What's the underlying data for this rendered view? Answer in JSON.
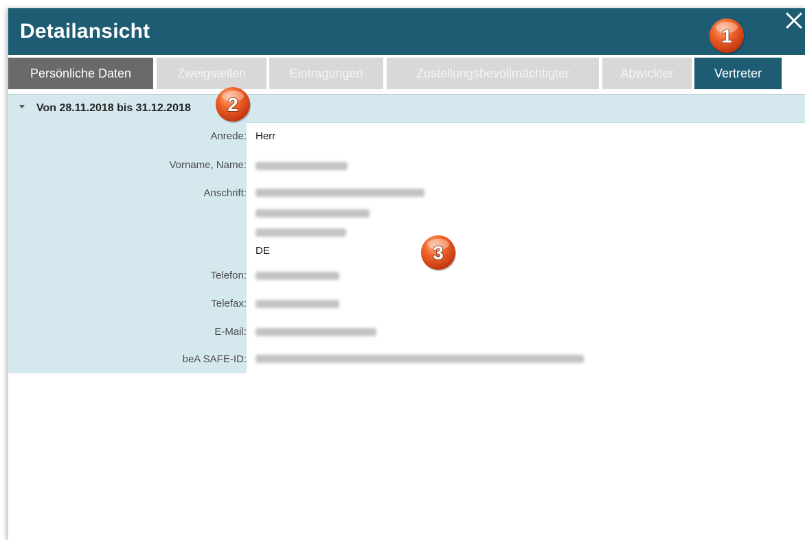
{
  "window": {
    "title": "Detailansicht"
  },
  "tabs": [
    {
      "label": "Persönliche Daten",
      "state": "active"
    },
    {
      "label": "Zweigstellen",
      "state": "inactive"
    },
    {
      "label": "Eintragungen",
      "state": "inactive"
    },
    {
      "label": "Zustellungsbevollmächtigter",
      "state": "inactive"
    },
    {
      "label": "Abwickler",
      "state": "inactive"
    },
    {
      "label": "Vertreter",
      "state": "selected"
    }
  ],
  "section": {
    "title": "Von 28.11.2018 bis 31.12.2018",
    "icon": "caret-down-icon"
  },
  "fields": {
    "anrede": {
      "label": "Anrede:",
      "value": "Herr"
    },
    "name": {
      "label": "Vorname, Name:"
    },
    "anschrift": {
      "label": "Anschrift:",
      "country": "DE"
    },
    "telefon": {
      "label": "Telefon:"
    },
    "telefax": {
      "label": "Telefax:"
    },
    "email": {
      "label": "E-Mail:"
    },
    "safe_id": {
      "label": "beA SAFE-ID:"
    }
  },
  "callouts": [
    "1",
    "2",
    "3"
  ],
  "colors": {
    "header": "#1e5c74",
    "label_column": "#d5e8ee",
    "badge": "#e8541e"
  }
}
